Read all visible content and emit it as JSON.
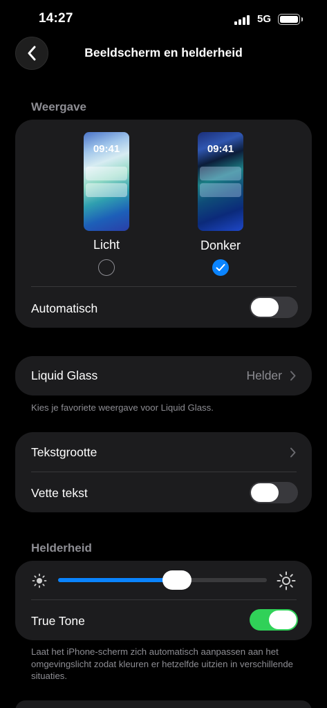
{
  "status_bar": {
    "time": "14:27",
    "network": "5G",
    "battery": "full"
  },
  "nav": {
    "title": "Beeldscherm en helderheid",
    "back_icon": "chevron-left-icon"
  },
  "appearance": {
    "section_title": "Weergave",
    "light": {
      "label": "Licht",
      "clock": "09:41",
      "selected": false
    },
    "dark": {
      "label": "Donker",
      "clock": "09:41",
      "selected": true
    },
    "automatic": {
      "label": "Automatisch",
      "on": false
    }
  },
  "liquid_glass": {
    "label": "Liquid Glass",
    "value": "Helder",
    "footnote": "Kies je favoriete weergave voor Liquid Glass."
  },
  "text": {
    "text_size_label": "Tekstgrootte",
    "bold_text": {
      "label": "Vette tekst",
      "on": false
    }
  },
  "brightness": {
    "section_title": "Helderheid",
    "level_percent": 57,
    "true_tone": {
      "label": "True Tone",
      "on": true
    },
    "footnote": "Laat het iPhone-scherm zich automatisch aanpassen aan het omgevingslicht zodat kleuren er hetzelfde uitzien in verschillende situaties."
  },
  "colors": {
    "accent": "#0a84ff",
    "toggle_on": "#30d158",
    "card": "#1c1c1e",
    "secondary_text": "#8d8d93"
  }
}
